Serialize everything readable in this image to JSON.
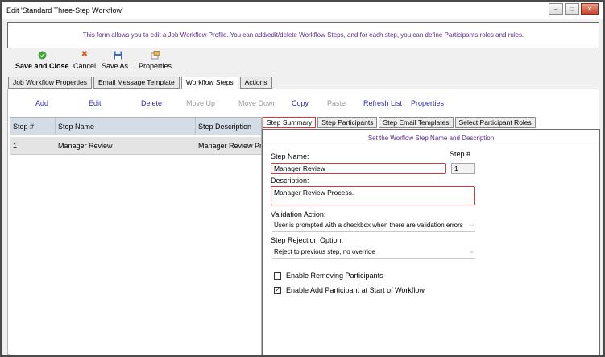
{
  "window": {
    "title": "Edit 'Standard Three-Step Workflow'"
  },
  "banner": {
    "text": "This form allows you to edit a Job Workflow Profile. You can add/edit/delete Workflow Steps, and for each step, you can define Participants roles and rules."
  },
  "toolbar": {
    "save_close": "Save and Close",
    "cancel": "Cancel",
    "save_as": "Save As...",
    "properties": "Properties"
  },
  "tabs": [
    {
      "label": "Job Workflow Properties"
    },
    {
      "label": "Email Message Template"
    },
    {
      "label": "Workflow Steps"
    },
    {
      "label": "Actions"
    }
  ],
  "step_actions": {
    "add": "Add",
    "edit": "Edit",
    "delete": "Delete",
    "move_up": "Move Up",
    "move_down": "Move Down",
    "copy": "Copy",
    "paste": "Paste",
    "refresh": "Refresh List",
    "properties": "Properties"
  },
  "grid": {
    "columns": [
      "Step #",
      "Step Name",
      "Step Description"
    ],
    "rows": [
      {
        "num": "1",
        "name": "Manager Review",
        "desc": "Manager Review Process."
      }
    ]
  },
  "detail_tabs": [
    {
      "label": "Step Summary"
    },
    {
      "label": "Step Participants"
    },
    {
      "label": "Step Email Templates"
    },
    {
      "label": "Select Participant Roles"
    }
  ],
  "detail": {
    "banner": "Set the Worflow Step Name and Description",
    "step_name_label": "Step Name:",
    "step_name_value": "Manager Review",
    "step_num_label": "Step #",
    "step_num_value": "1",
    "description_label": "Description:",
    "description_value": "Manager Review Process.",
    "validation_label": "Validation Action:",
    "validation_value": "User is prompted with a checkbox when there are validation errors",
    "rejection_label": "Step Rejection Option:",
    "rejection_value": "Reject to previous step, no override",
    "cb_remove_label": "Enable Removing Participants",
    "cb_remove_checked": false,
    "cb_add_label": "Enable Add Participant at Start of Workflow",
    "cb_add_checked": true
  },
  "colors": {
    "link": "#2a2aa8",
    "banner_text": "#5a2a8a",
    "highlight": "#d8363a",
    "grid_header": "#d4dde6"
  }
}
